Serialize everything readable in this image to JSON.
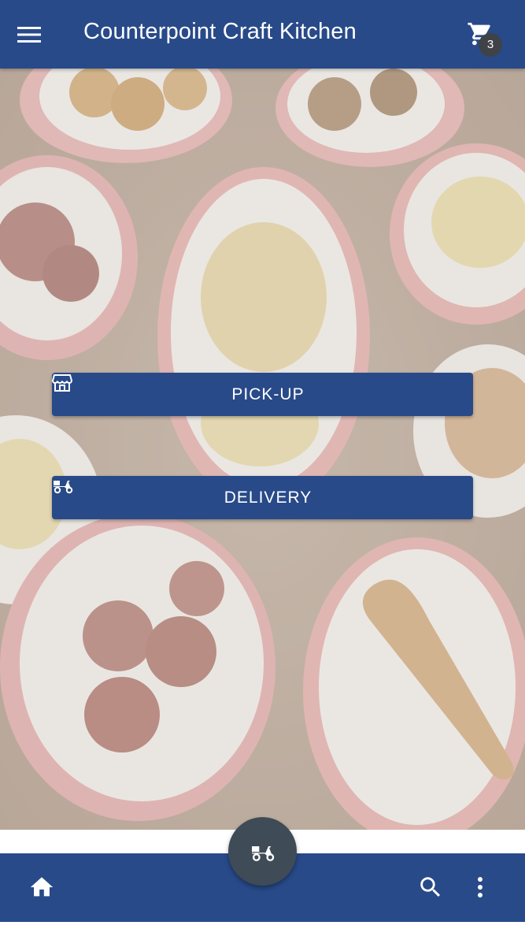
{
  "app": {
    "title": "Counterpoint Craft Kitchen",
    "primary_color": "#284a89"
  },
  "header": {
    "menu_icon": "hamburger-menu-icon",
    "cart_icon": "shopping-cart-icon",
    "cart_count": "3"
  },
  "actions": {
    "pickup_label": "PICK-UP",
    "pickup_icon": "storefront-icon",
    "delivery_label": "DELIVERY",
    "delivery_icon": "scooter-icon"
  },
  "bottom_nav": {
    "home_icon": "home-icon",
    "search_icon": "search-icon",
    "more_icon": "more-vertical-icon",
    "fab_icon": "scooter-icon"
  }
}
